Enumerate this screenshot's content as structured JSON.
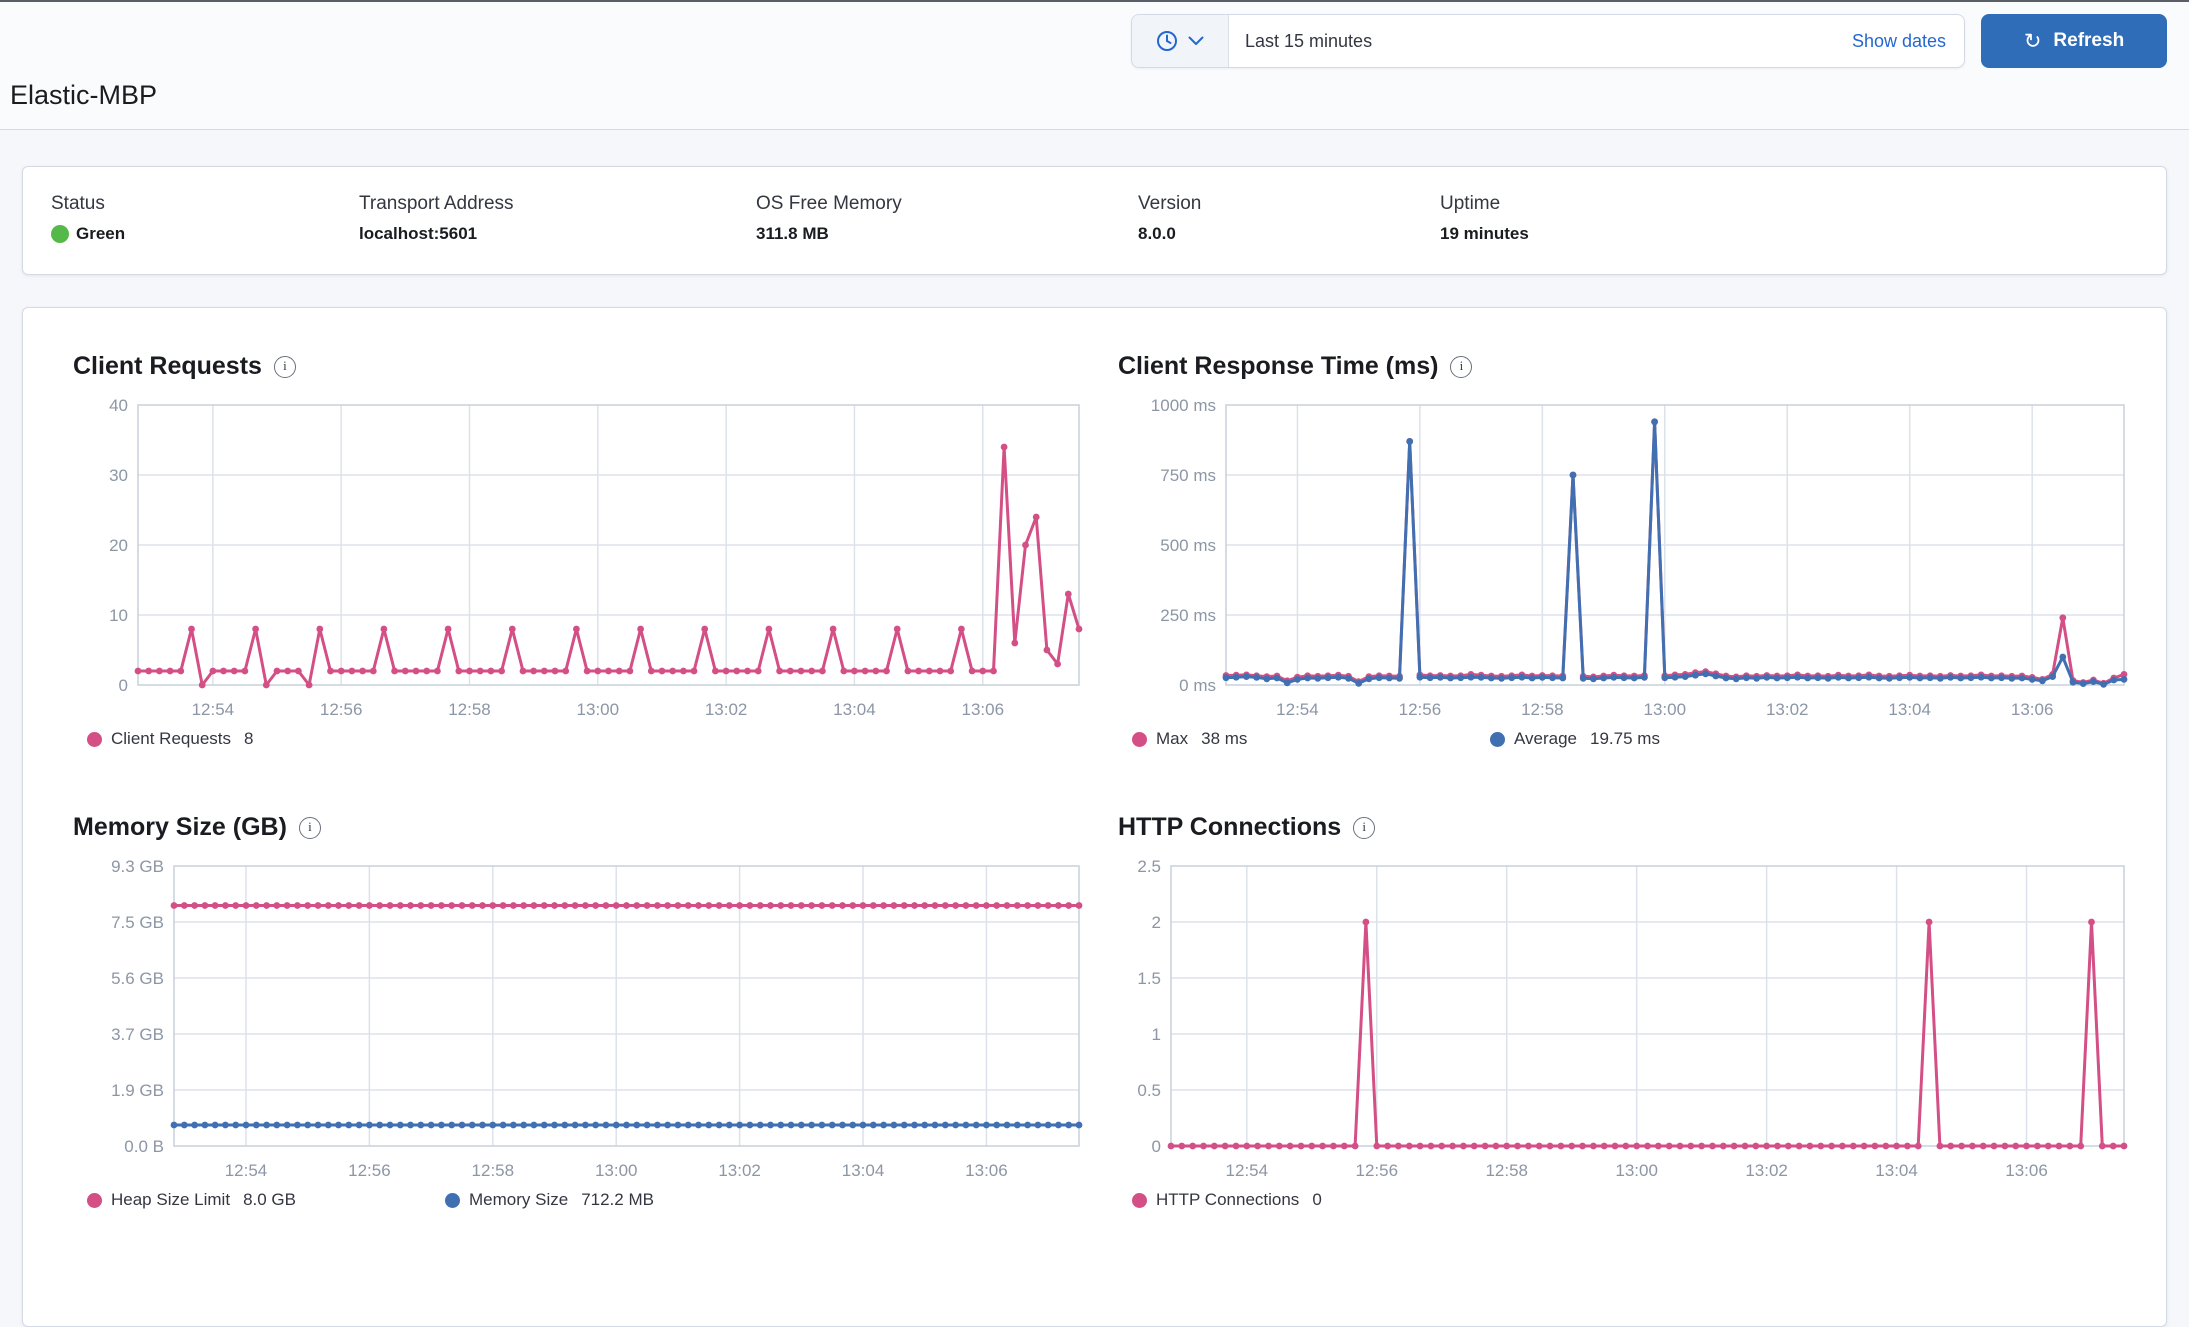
{
  "header": {
    "title": "Elastic-MBP",
    "time_picker": {
      "value": "Last 15 minutes",
      "show_dates_label": "Show dates"
    },
    "refresh_button": {
      "label": "Refresh",
      "icon": "refresh-icon",
      "glyph": "↻"
    }
  },
  "status_bar": {
    "items": [
      {
        "label": "Status",
        "value": "Green",
        "status_color": "#54b948"
      },
      {
        "label": "Transport Address",
        "value": "localhost:5601"
      },
      {
        "label": "OS Free Memory",
        "value": "311.8 MB"
      },
      {
        "label": "Version",
        "value": "8.0.0"
      },
      {
        "label": "Uptime",
        "value": "19 minutes"
      }
    ]
  },
  "colors": {
    "pink": "#d34f86",
    "blue": "#4070b2",
    "grid": "#dde2ea",
    "plot_border": "#c9d0da",
    "axis_text": "#8c96a5"
  },
  "chart_data": [
    {
      "type": "line",
      "title": "Client Requests",
      "x_start": "12:52:50",
      "x_end": "13:07:30",
      "x_ticks": [
        "12:54",
        "12:56",
        "12:58",
        "13:00",
        "13:02",
        "13:04",
        "13:06"
      ],
      "ymin": 0,
      "ymax": 40,
      "y_ticks": [
        {
          "v": 40,
          "label": "40"
        },
        {
          "v": 30,
          "label": "30"
        },
        {
          "v": 20,
          "label": "20"
        },
        {
          "v": 10,
          "label": "10"
        },
        {
          "v": 0,
          "label": "0"
        }
      ],
      "series": [
        {
          "name": "Client Requests",
          "color": "#d34f86",
          "legend_label": "Client Requests",
          "legend_value": "8",
          "values": [
            2,
            2,
            2,
            2,
            2,
            8,
            0,
            2,
            2,
            2,
            2,
            8,
            0,
            2,
            2,
            2,
            0,
            8,
            2,
            2,
            2,
            2,
            2,
            8,
            2,
            2,
            2,
            2,
            2,
            8,
            2,
            2,
            2,
            2,
            2,
            8,
            2,
            2,
            2,
            2,
            2,
            8,
            2,
            2,
            2,
            2,
            2,
            8,
            2,
            2,
            2,
            2,
            2,
            8,
            2,
            2,
            2,
            2,
            2,
            8,
            2,
            2,
            2,
            2,
            2,
            8,
            2,
            2,
            2,
            2,
            2,
            8,
            2,
            2,
            2,
            2,
            2,
            8,
            2,
            2,
            2,
            34,
            6,
            20,
            24,
            5,
            3,
            13,
            8
          ]
        }
      ]
    },
    {
      "type": "line",
      "title": "Client Response Time (ms)",
      "x_start": "12:52:50",
      "x_end": "13:07:30",
      "x_ticks": [
        "12:54",
        "12:56",
        "12:58",
        "13:00",
        "13:02",
        "13:04",
        "13:06"
      ],
      "ymin": 0,
      "ymax": 1000,
      "y_ticks": [
        {
          "v": 1000,
          "label": "1000 ms"
        },
        {
          "v": 750,
          "label": "750 ms"
        },
        {
          "v": 500,
          "label": "500 ms"
        },
        {
          "v": 250,
          "label": "250 ms"
        },
        {
          "v": 0,
          "label": "0 ms"
        }
      ],
      "series": [
        {
          "name": "Max",
          "color": "#d34f86",
          "legend_label": "Max",
          "legend_value": "38 ms",
          "values": [
            34,
            35,
            36,
            33,
            30,
            32,
            15,
            28,
            33,
            31,
            33,
            35,
            31,
            12,
            30,
            33,
            32,
            31,
            870,
            36,
            33,
            34,
            32,
            33,
            38,
            35,
            32,
            31,
            33,
            36,
            32,
            34,
            33,
            32,
            750,
            31,
            29,
            32,
            35,
            33,
            32,
            34,
            940,
            33,
            36,
            38,
            44,
            48,
            40,
            32,
            29,
            33,
            31,
            34,
            32,
            33,
            36,
            32,
            33,
            31,
            35,
            32,
            33,
            36,
            32,
            31,
            33,
            35,
            32,
            33,
            31,
            34,
            32,
            33,
            36,
            32,
            33,
            31,
            32,
            27,
            20,
            38,
            240,
            16,
            9,
            18,
            6,
            25,
            38
          ]
        },
        {
          "name": "Average",
          "color": "#4070b2",
          "legend_label": "Average",
          "legend_value": "19.75 ms",
          "values": [
            26,
            28,
            30,
            27,
            22,
            25,
            8,
            20,
            25,
            24,
            26,
            28,
            24,
            6,
            22,
            26,
            25,
            24,
            870,
            28,
            26,
            27,
            25,
            26,
            28,
            27,
            25,
            24,
            26,
            28,
            25,
            27,
            26,
            25,
            750,
            24,
            22,
            25,
            27,
            26,
            25,
            27,
            940,
            26,
            28,
            30,
            35,
            40,
            32,
            25,
            22,
            26,
            24,
            27,
            25,
            26,
            28,
            25,
            26,
            24,
            27,
            25,
            26,
            28,
            25,
            24,
            26,
            27,
            25,
            26,
            24,
            27,
            25,
            26,
            28,
            25,
            26,
            24,
            25,
            20,
            15,
            30,
            100,
            10,
            5,
            12,
            2,
            18,
            20
          ]
        }
      ]
    },
    {
      "type": "line",
      "title": "Memory Size (GB)",
      "x_start": "12:52:50",
      "x_end": "13:07:30",
      "x_ticks": [
        "12:54",
        "12:56",
        "12:58",
        "13:00",
        "13:02",
        "13:04",
        "13:06"
      ],
      "ymin": 0,
      "ymax": 10,
      "y_ticks": [
        {
          "v": 10,
          "label": "9.3 GB"
        },
        {
          "v": 8,
          "label": "7.5 GB"
        },
        {
          "v": 6,
          "label": "5.6 GB"
        },
        {
          "v": 4,
          "label": "3.7 GB"
        },
        {
          "v": 2,
          "label": "1.9 GB"
        },
        {
          "v": 0,
          "label": "0.0 B"
        }
      ],
      "series": [
        {
          "name": "Heap Size Limit",
          "color": "#d34f86",
          "legend_label": "Heap Size Limit",
          "legend_value": "8.0 GB",
          "const": 8.59,
          "count": 89
        },
        {
          "name": "Memory Size",
          "color": "#4070b2",
          "legend_label": "Memory Size",
          "legend_value": "712.2 MB",
          "const": 0.75,
          "count": 89
        }
      ]
    },
    {
      "type": "line",
      "title": "HTTP Connections",
      "x_start": "12:52:50",
      "x_end": "13:07:30",
      "x_ticks": [
        "12:54",
        "12:56",
        "12:58",
        "13:00",
        "13:02",
        "13:04",
        "13:06"
      ],
      "ymin": 0,
      "ymax": 2.5,
      "y_ticks": [
        {
          "v": 2.5,
          "label": "2.5"
        },
        {
          "v": 2,
          "label": "2"
        },
        {
          "v": 1.5,
          "label": "1.5"
        },
        {
          "v": 1,
          "label": "1"
        },
        {
          "v": 0.5,
          "label": "0.5"
        },
        {
          "v": 0,
          "label": "0"
        }
      ],
      "series": [
        {
          "name": "HTTP Connections",
          "color": "#d34f86",
          "legend_label": "HTTP Connections",
          "legend_value": "0",
          "values": [
            0,
            0,
            0,
            0,
            0,
            0,
            0,
            0,
            0,
            0,
            0,
            0,
            0,
            0,
            0,
            0,
            0,
            0,
            2,
            0,
            0,
            0,
            0,
            0,
            0,
            0,
            0,
            0,
            0,
            0,
            0,
            0,
            0,
            0,
            0,
            0,
            0,
            0,
            0,
            0,
            0,
            0,
            0,
            0,
            0,
            0,
            0,
            0,
            0,
            0,
            0,
            0,
            0,
            0,
            0,
            0,
            0,
            0,
            0,
            0,
            0,
            0,
            0,
            0,
            0,
            0,
            0,
            0,
            0,
            0,
            2,
            0,
            0,
            0,
            0,
            0,
            0,
            0,
            0,
            0,
            0,
            0,
            0,
            0,
            0,
            2,
            0,
            0,
            0
          ]
        }
      ]
    }
  ]
}
